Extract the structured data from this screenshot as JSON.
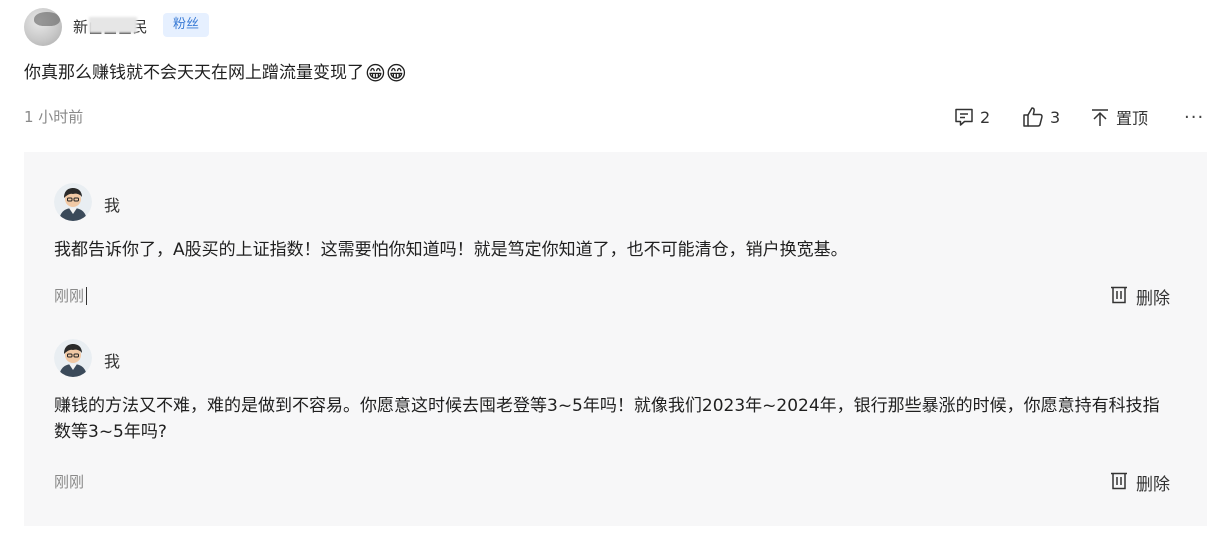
{
  "comment": {
    "username": "新■■■民",
    "badge": "粉丝",
    "text": "你真那么赚钱就不会天天在网上蹭流量变现了",
    "emoji": "😁😁",
    "time": "1 小时前",
    "actions": {
      "reply_count": "2",
      "like_count": "3",
      "pin_label": "置顶",
      "more_label": "···"
    }
  },
  "replies": [
    {
      "author": "我",
      "text": "我都告诉你了，A股买的上证指数！这需要怕你知道吗！就是笃定你知道了，也不可能清仓，销户换宽基。",
      "time": "刚刚",
      "delete_label": "删除"
    },
    {
      "author": "我",
      "text": "赚钱的方法又不难，难的是做到不容易。你愿意这时候去囤老登等3~5年吗！就像我们2023年~2024年，银行那些暴涨的时候，你愿意持有科技指数等3~5年吗?",
      "time": "刚刚",
      "delete_label": "删除"
    }
  ],
  "colors": {
    "badge_bg": "#e6f0ff",
    "badge_text": "#3a7bd5",
    "replies_bg": "#f7f7f8",
    "muted_text": "#8a8a8a"
  }
}
